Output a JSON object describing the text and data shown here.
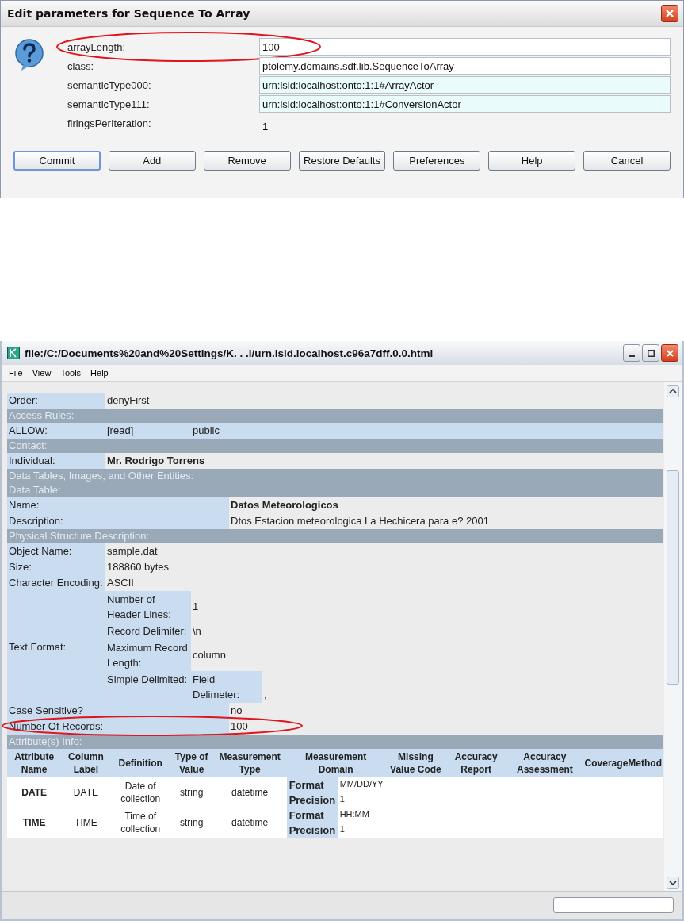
{
  "dialog": {
    "title": "Edit parameters for Sequence To Array",
    "params": [
      {
        "label": "arrayLength:",
        "value": "100",
        "kind": "field",
        "circled": true
      },
      {
        "label": "class:",
        "value": "ptolemy.domains.sdf.lib.SequenceToArray",
        "kind": "field",
        "circled": false
      },
      {
        "label": "semanticType000:",
        "value": "urn:lsid:localhost:onto:1:1#ArrayActor",
        "kind": "tinted_field",
        "circled": false
      },
      {
        "label": "semanticType111:",
        "value": "urn:lsid:localhost:onto:1:1#ConversionActor",
        "kind": "tinted_field",
        "circled": false
      },
      {
        "label": "firingsPerIteration:",
        "value": "1",
        "kind": "text",
        "circled": false
      }
    ],
    "buttons": [
      {
        "label": "Commit",
        "default": true
      },
      {
        "label": "Add",
        "default": false
      },
      {
        "label": "Remove",
        "default": false
      },
      {
        "label": "Restore Defaults",
        "default": false
      },
      {
        "label": "Preferences",
        "default": false
      },
      {
        "label": "Help",
        "default": false
      },
      {
        "label": "Cancel",
        "default": false
      }
    ]
  },
  "browser": {
    "title": "file:/C:/Documents%20and%20Settings/K. . .l/urn.lsid.localhost.c96a7dff.0.0.html",
    "menu": [
      "File",
      "View",
      "Tools",
      "Help"
    ],
    "rows": [
      {
        "kind": "pair",
        "label": "Order:",
        "values": [
          "denyFirst"
        ],
        "bold": false,
        "wide": false,
        "tinted": false,
        "circled": false
      },
      {
        "kind": "header",
        "label": "Access Rules:"
      },
      {
        "kind": "pair",
        "label": "ALLOW:",
        "values": [
          "[read]",
          "public"
        ],
        "bold": false,
        "wide": false,
        "tinted": true,
        "circled": false
      },
      {
        "kind": "header",
        "label": "Contact:"
      },
      {
        "kind": "pair",
        "label": "Individual:",
        "values": [
          "Mr. Rodrigo Torrens"
        ],
        "bold": true,
        "wide": false,
        "tinted": false,
        "circled": false
      },
      {
        "kind": "header",
        "label": "Data Tables, Images, and Other Entities:"
      },
      {
        "kind": "header",
        "label": "Data Table:"
      },
      {
        "kind": "pair",
        "label": "Name:",
        "values": [
          "Datos Meteorologicos"
        ],
        "bold": true,
        "wide": true,
        "tinted": false,
        "circled": false
      },
      {
        "kind": "pair",
        "label": "Description:",
        "values": [
          "Dtos Estacion meteorologica La Hechicera para e? 2001"
        ],
        "bold": false,
        "wide": true,
        "tinted": false,
        "circled": false
      },
      {
        "kind": "header",
        "label": "Physical Structure Description:"
      },
      {
        "kind": "pair",
        "label": "Object Name:",
        "values": [
          "sample.dat"
        ],
        "bold": false,
        "wide": false,
        "tinted": false,
        "circled": false
      },
      {
        "kind": "pair",
        "label": "Size:",
        "values": [
          "188860 bytes"
        ],
        "bold": false,
        "wide": false,
        "tinted": false,
        "circled": false
      },
      {
        "kind": "pair",
        "label": "Character Encoding:",
        "values": [
          "ASCII"
        ],
        "bold": false,
        "wide": false,
        "tinted": false,
        "circled": false
      },
      {
        "kind": "group",
        "label": "Text Format:",
        "items": [
          {
            "label": "Number of Header Lines:",
            "value": "1"
          },
          {
            "label": "Record Delimiter:",
            "value": "\\n"
          },
          {
            "label": "Maximum Record Length:",
            "value": "column"
          },
          {
            "label": "Simple Delimited:",
            "sub": {
              "label": "Field Delimeter:",
              "value": ","
            }
          }
        ]
      },
      {
        "kind": "pair",
        "label": "Case Sensitive?",
        "values": [
          "no"
        ],
        "bold": false,
        "wide": true,
        "tinted": false,
        "circled": false
      },
      {
        "kind": "pair",
        "label": "Number Of Records:",
        "values": [
          "100"
        ],
        "bold": false,
        "wide": true,
        "tinted": false,
        "circled": true
      },
      {
        "kind": "header",
        "label": "Attribute(s) Info:"
      }
    ],
    "attributes": {
      "columns": [
        "Attribute Name",
        "Column Label",
        "Definition",
        "Type of Value",
        "Measurement Type",
        "Measurement Domain",
        "Missing Value Code",
        "Accuracy Report",
        "Accuracy Assessment",
        "CoverageMethod"
      ],
      "rows": [
        {
          "cells": [
            "DATE",
            "DATE",
            "Date of collection",
            "string",
            "datetime"
          ],
          "domain": [
            {
              "label": "Format",
              "value": "MM/DD/YY"
            },
            {
              "label": "Precision",
              "value": "1"
            }
          ]
        },
        {
          "cells": [
            "TIME",
            "TIME",
            "Time of collection",
            "string",
            "datetime"
          ],
          "domain": [
            {
              "label": "Format",
              "value": "HH:MM"
            },
            {
              "label": "Precision",
              "value": "1"
            }
          ]
        }
      ]
    }
  }
}
